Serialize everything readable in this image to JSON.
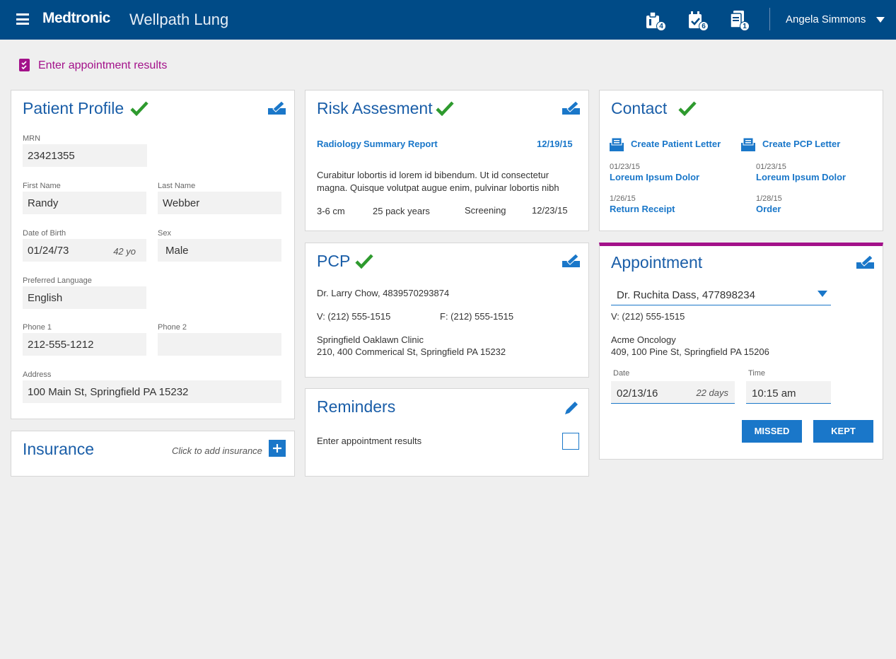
{
  "header": {
    "brand": "Medtronic",
    "product": "Wellpath Lung",
    "badges": [
      "4",
      "6",
      "1"
    ],
    "user": "Angela Simmons"
  },
  "task": {
    "label": "Enter appointment results"
  },
  "patient": {
    "title": "Patient Profile",
    "mrn_label": "MRN",
    "mrn": "23421355",
    "first_label": "First Name",
    "first": "Randy",
    "last_label": "Last Name",
    "last": "Webber",
    "dob_label": "Date of Birth",
    "dob": "01/24/73",
    "age": "42 yo",
    "sex_label": "Sex",
    "sex": "Male",
    "lang_label": "Preferred Language",
    "lang": "English",
    "phone1_label": "Phone 1",
    "phone1": "212-555-1212",
    "phone2_label": "Phone 2",
    "phone2": "",
    "address_label": "Address",
    "address": "100 Main St, Springfield PA 15232"
  },
  "insurance": {
    "title": "Insurance",
    "hint": "Click to add insurance"
  },
  "risk": {
    "title": "Risk Assesment",
    "link1": "Radiology",
    "link2": "Summary Report",
    "date": "12/19/15",
    "body1": "Curabitur lobortis id lorem id bibendum. Ut id consectetur",
    "body2": "magna. Quisque volutpat augue enim, pulvinar lobortis nibh",
    "size": "3-6 cm",
    "pack": "25 pack years",
    "type": "Screening",
    "type_date": "12/23/15"
  },
  "pcp": {
    "title": "PCP",
    "doctor": "Dr. Larry Chow, 4839570293874",
    "voice": "V: (212) 555-1515",
    "fax": "F: (212) 555-1515",
    "clinic": "Springfield Oaklawn Clinic",
    "address": "210, 400 Commerical St, Springfield PA 15232"
  },
  "reminders": {
    "title": "Reminders",
    "item": "Enter appointment results"
  },
  "contact": {
    "title": "Contact",
    "create_patient": "Create Patient Letter",
    "create_pcp": "Create PCP Letter",
    "a_date": "01/23/15",
    "a_link": "Loreum Ipsum Dolor",
    "b_date": "01/23/15",
    "b_link": "Loreum Ipsum Dolor",
    "c_date": "1/26/15",
    "c_link": "Return Receipt",
    "d_date": "1/28/15",
    "d_link": "Order"
  },
  "appointment": {
    "title": "Appointment",
    "doctor": "Dr. Ruchita Dass, 477898234",
    "voice": "V: (212) 555-1515",
    "clinic": "Acme Oncology",
    "address": "409, 100 Pine St, Springfield PA 15206",
    "date_label": "Date",
    "date": "02/13/16",
    "days": "22 days",
    "time_label": "Time",
    "time": "10:15 am",
    "missed": "MISSED",
    "kept": "KEPT"
  }
}
